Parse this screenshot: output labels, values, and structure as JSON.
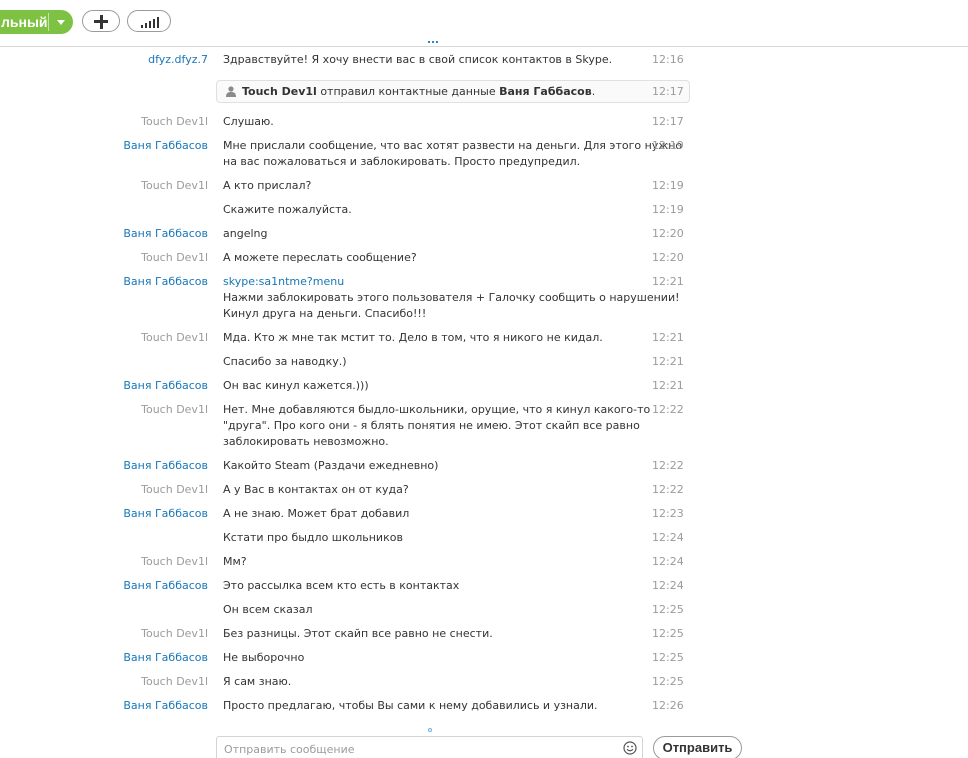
{
  "toolbar": {
    "status_label": "льный",
    "status_color": "#7dc242",
    "add_button_icon": "plus-icon",
    "call_quality_icon": "signal-bars-icon",
    "loading_indicator": "more-dots-icon"
  },
  "accent_color": "#1777b7",
  "messages": [
    {
      "sender": "dfyz.dfyz.7",
      "sender_style": "blue",
      "lines": [
        "Здравствуйте! Я хочу внести вас в свой список контактов в Skype."
      ],
      "time": "12:16"
    },
    {
      "sender": "Touch Dev1l",
      "sender_style": "gray",
      "lines": [
        "Слушаю."
      ],
      "time": "12:17"
    },
    {
      "sender": "Ваня Габбасов",
      "sender_style": "blue",
      "lines": [
        "Мне прислали сообщение, что вас хотят развести на деньги. Для этого нужно",
        "на вас пожаловаться и заблокировать. Просто предупредил."
      ],
      "time": "12:19"
    },
    {
      "sender": "Touch Dev1l",
      "sender_style": "gray",
      "lines": [
        "А кто прислал?"
      ],
      "time": "12:19"
    },
    {
      "sender": "",
      "sender_style": "gray",
      "lines": [
        "Скажите пожалуйста."
      ],
      "time": "12:19"
    },
    {
      "sender": "Ваня Габбасов",
      "sender_style": "blue",
      "lines": [
        "angelng"
      ],
      "time": "12:20"
    },
    {
      "sender": "Touch Dev1l",
      "sender_style": "gray",
      "lines": [
        "А можете переслать сообщение?"
      ],
      "time": "12:20"
    },
    {
      "sender": "Ваня Габбасов",
      "sender_style": "blue",
      "link": "skype:sa1ntme?menu",
      "lines": [
        "Нажми заблокировать этого пользователя + Галочку сообщить о нарушении!",
        "Кинул друга на деньги. Спасибо!!!"
      ],
      "time": "12:21"
    },
    {
      "sender": "Touch Dev1l",
      "sender_style": "gray",
      "lines": [
        "Мда. Кто ж мне так мстит то. Дело в том, что я никого не кидал."
      ],
      "time": "12:21"
    },
    {
      "sender": "",
      "sender_style": "gray",
      "lines": [
        "Спасибо за наводку.)"
      ],
      "time": "12:21"
    },
    {
      "sender": "Ваня Габбасов",
      "sender_style": "blue",
      "lines": [
        "Он вас кинул кажется.)))"
      ],
      "time": "12:21"
    },
    {
      "sender": "Touch Dev1l",
      "sender_style": "gray",
      "lines": [
        "Нет. Мне добавляются быдло-школьники, орущие, что я кинул какого-то",
        "\"друга\". Про кого они - я блять понятия не имею. Этот скайп все равно",
        "заблокировать невозможно."
      ],
      "time": "12:22"
    },
    {
      "sender": "Ваня Габбасов",
      "sender_style": "blue",
      "lines": [
        "Какойто Steam (Раздачи ежедневно)"
      ],
      "time": "12:22"
    },
    {
      "sender": "Touch Dev1l",
      "sender_style": "gray",
      "lines": [
        "А у Вас в контактах он от куда?"
      ],
      "time": "12:22"
    },
    {
      "sender": "Ваня Габбасов",
      "sender_style": "blue",
      "lines": [
        "А не знаю. Может брат добавил"
      ],
      "time": "12:23"
    },
    {
      "sender": "",
      "sender_style": "blue",
      "lines": [
        "Кстати про быдло школьников"
      ],
      "time": "12:24"
    },
    {
      "sender": "Touch Dev1l",
      "sender_style": "gray",
      "lines": [
        "Мм?"
      ],
      "time": "12:24"
    },
    {
      "sender": "Ваня Габбасов",
      "sender_style": "blue",
      "lines": [
        "Это рассылка всем кто есть в контактах"
      ],
      "time": "12:24"
    },
    {
      "sender": "",
      "sender_style": "blue",
      "lines": [
        "Он всем сказал"
      ],
      "time": "12:25"
    },
    {
      "sender": "Touch Dev1l",
      "sender_style": "gray",
      "lines": [
        "Без разницы. Этот скайп все равно не снести."
      ],
      "time": "12:25"
    },
    {
      "sender": "Ваня Габбасов",
      "sender_style": "blue",
      "lines": [
        "Не выборочно"
      ],
      "time": "12:25"
    },
    {
      "sender": "Touch Dev1l",
      "sender_style": "gray",
      "lines": [
        "Я сам знаю."
      ],
      "time": "12:25"
    },
    {
      "sender": "Ваня Габбасов",
      "sender_style": "blue",
      "lines": [
        "Просто предлагаю, чтобы Вы сами к нему добавились и узнали."
      ],
      "time": "12:26"
    }
  ],
  "contact_card": {
    "icon": "person-icon",
    "from": "Touch Dev1l",
    "middle": "отправил контактные данные",
    "contact": "Ваня Габбасов",
    "end": ".",
    "time": "12:17"
  },
  "composer": {
    "placeholder": "Отправить сообщение",
    "value": "",
    "emoticon_icon": "emoticon-icon",
    "send_label": "Отправить"
  }
}
